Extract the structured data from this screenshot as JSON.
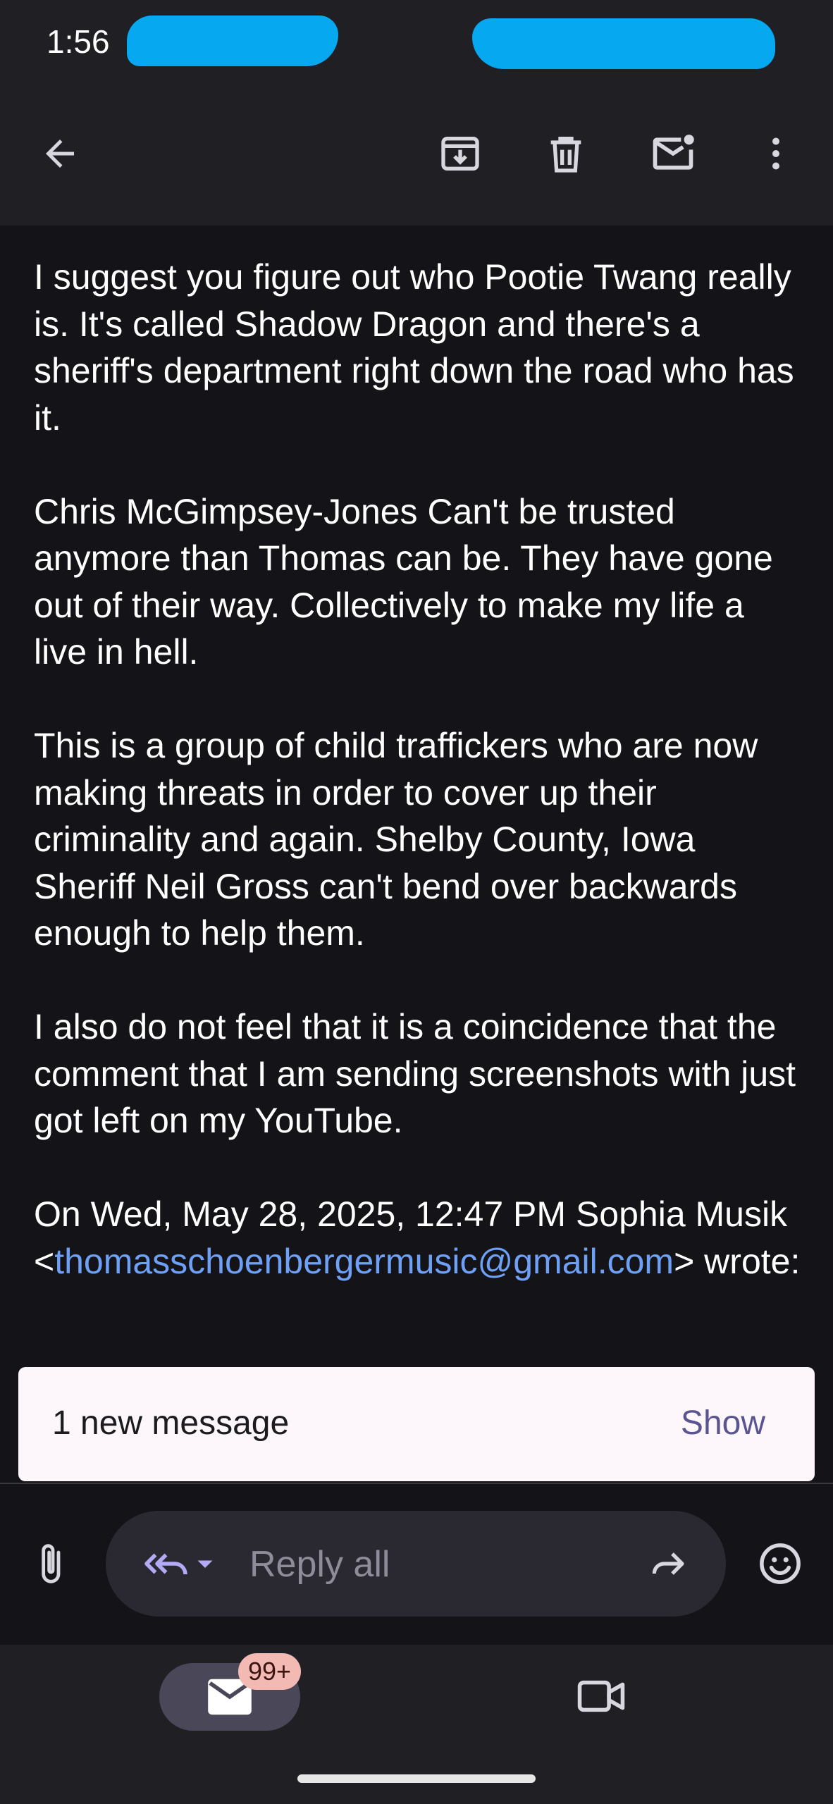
{
  "status_bar": {
    "time": "1:56"
  },
  "email": {
    "paragraphs": [
      "I suggest you figure out who Pootie Twang really is. It's called Shadow Dragon and there's a sheriff's department right down the road who has it.",
      "Chris McGimpsey-Jones Can't be trusted anymore than Thomas can be. They have gone out of their way. Collectively to make my life a live in hell.",
      "This is a group of child traffickers who are now making threats in order to cover up their criminality and again. Shelby County, Iowa Sheriff Neil Gross can't bend over backwards enough to help them.",
      "I also do not feel that it is a coincidence that the comment that I am sending screenshots with just got left on my YouTube."
    ],
    "quote_header": {
      "prefix": "On Wed, May 28, 2025, 12:47 PM Sophia Musik <",
      "email": "thomasschoenbergermusic@gmail.com",
      "suffix": "> wrote:"
    }
  },
  "toast": {
    "text": "1 new message",
    "action": "Show"
  },
  "reply_bar": {
    "reply_label": "Reply all"
  },
  "bottom_nav": {
    "mail_badge": "99+"
  },
  "colors": {
    "background": "#141318",
    "bar": "#1f1f24",
    "link": "#6ea0f5",
    "accent": "#b3aaf5",
    "toast_bg": "#fdf7fc",
    "badge_bg": "#f3b9b3"
  }
}
